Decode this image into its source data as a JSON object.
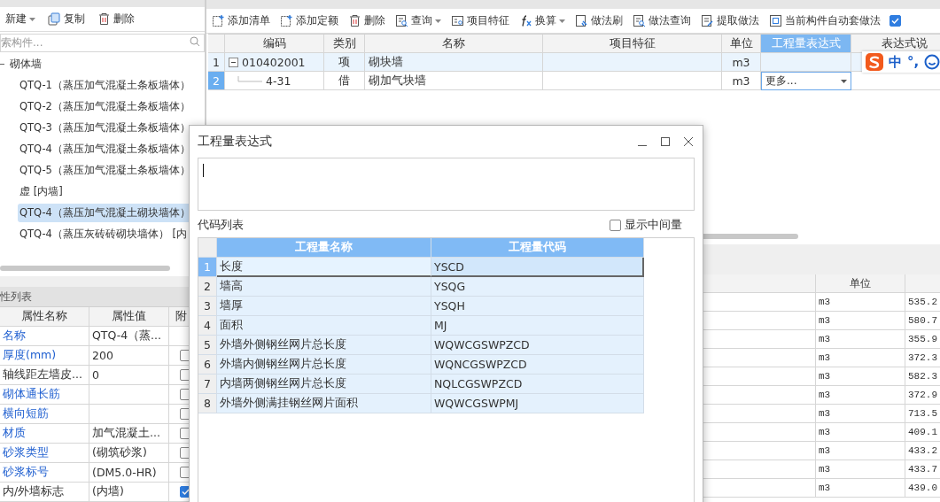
{
  "component_panel": {
    "toolbar": [
      {
        "label": "新建",
        "kind": "new",
        "dropdown": true
      },
      {
        "label": "复制",
        "kind": "copy",
        "dropdown": false
      },
      {
        "label": "删除",
        "kind": "delete",
        "dropdown": false
      }
    ],
    "search": {
      "placeholder": "索构件..."
    },
    "tree": [
      {
        "label": "砌体墙",
        "expanded": true,
        "selected": false,
        "children": [
          {
            "label": "QTQ-1（蒸压加气混凝土条板墙体）",
            "selected": false
          },
          {
            "label": "QTQ-2（蒸压加气混凝土条板墙体）",
            "selected": false
          },
          {
            "label": "QTQ-3（蒸压加气混凝土条板墙体）",
            "selected": false
          },
          {
            "label": "QTQ-4（蒸压加气混凝土条板墙体）",
            "selected": false
          },
          {
            "label": "QTQ-5（蒸压加气混凝土条板墙体）",
            "selected": false
          },
          {
            "label": "虚 [内墙]",
            "selected": false
          },
          {
            "label": "QTQ-4（蒸压加气混凝土砌块墙体）",
            "selected": true
          },
          {
            "label": "QTQ-4（蒸压灰砖砖砌块墙体） [内",
            "selected": false
          }
        ]
      }
    ]
  },
  "property_panel": {
    "title": "性列表",
    "columns": [
      "属性名称",
      "属性值",
      "附"
    ],
    "rows": [
      {
        "name": "名称",
        "value": "QTQ-4（蒸...",
        "kind": "public"
      },
      {
        "name": "厚度(mm)",
        "value": "200",
        "kind": "public",
        "checked": false
      },
      {
        "name": "轴线距左墙皮...",
        "value": "0",
        "kind": "private",
        "checked": false
      },
      {
        "name": "砌体通长筋",
        "value": "",
        "kind": "public",
        "checked": false
      },
      {
        "name": "横向短筋",
        "value": "",
        "kind": "public",
        "checked": false
      },
      {
        "name": "材质",
        "value": "加气混凝土...",
        "kind": "public",
        "checked": false
      },
      {
        "name": "砂浆类型",
        "value": "(砌筑砂浆)",
        "kind": "public",
        "checked": false
      },
      {
        "name": "砂浆标号",
        "value": "(DM5.0-HR)",
        "kind": "public",
        "checked": false
      },
      {
        "name": "内/外墙标志",
        "value": "(内墙)",
        "kind": "private",
        "checked": true
      }
    ]
  },
  "method_panel": {
    "toolbar": [
      {
        "label": "添加清单",
        "kind": "add-list",
        "dropdown": false
      },
      {
        "label": "添加定额",
        "kind": "add-quota",
        "dropdown": false
      },
      {
        "label": "删除",
        "kind": "delete",
        "dropdown": false
      },
      {
        "label": "查询",
        "kind": "query",
        "dropdown": true
      },
      {
        "label": "项目特征",
        "kind": "feature",
        "dropdown": false
      },
      {
        "label": "换算",
        "kind": "function",
        "dropdown": true
      },
      {
        "label": "做法刷",
        "kind": "brush",
        "dropdown": false
      },
      {
        "label": "做法查询",
        "kind": "query",
        "dropdown": false
      },
      {
        "label": "提取做法",
        "kind": "extract",
        "dropdown": false
      },
      {
        "label": "当前构件自动套做法",
        "kind": "auto",
        "dropdown": false
      }
    ],
    "auto_checkbox": {
      "checked": true
    },
    "columns": [
      {
        "label": "编码",
        "selected": false
      },
      {
        "label": "类别",
        "selected": false
      },
      {
        "label": "名称",
        "selected": false
      },
      {
        "label": "项目特征",
        "selected": false
      },
      {
        "label": "单位",
        "selected": false
      },
      {
        "label": "工程量表达式",
        "selected": true
      },
      {
        "label": "表达式说",
        "selected": false
      }
    ],
    "rows": [
      {
        "index": "1",
        "code": "010402001",
        "category": "项",
        "name": "砌块墙",
        "unit": "m3",
        "selected": false,
        "expanded": true,
        "children": [
          {
            "index": "2",
            "code": "4-31",
            "category": "借",
            "name": "砌加气块墙",
            "unit": "m3",
            "selected": true,
            "expression": {
              "kind": "dropdown",
              "value": "更多..."
            }
          }
        ]
      }
    ]
  },
  "ime_bar": {
    "items": [
      "中",
      "°,"
    ]
  },
  "quantity_table": {
    "columns": [
      "单位"
    ],
    "rows": [
      {
        "unit": "m3",
        "value": "535.2"
      },
      {
        "unit": "m3",
        "value": "580.7"
      },
      {
        "unit": "m3",
        "value": "355.9"
      },
      {
        "unit": "m3",
        "value": "372.3"
      },
      {
        "unit": "m3",
        "value": "582.3"
      },
      {
        "unit": "m3",
        "value": "372.9"
      },
      {
        "unit": "m3",
        "value": "713.5"
      },
      {
        "unit": "m3",
        "value": "409.1"
      },
      {
        "unit": "m3",
        "value": "433.2"
      },
      {
        "unit": "m3",
        "value": "433.7"
      },
      {
        "unit": "m3",
        "value": "439.0"
      }
    ]
  },
  "dialog": {
    "title": "工程量表达式",
    "code_list_label": "代码列表",
    "show_intermediate": {
      "label": "显示中间量",
      "checked": false
    },
    "columns": [
      "工程量名称",
      "工程量代码"
    ],
    "rows": [
      {
        "index": "1",
        "name": "长度",
        "code": "YSCD",
        "selected": true
      },
      {
        "index": "2",
        "name": "墙高",
        "code": "YSQG",
        "selected": false
      },
      {
        "index": "3",
        "name": "墙厚",
        "code": "YSQH",
        "selected": false
      },
      {
        "index": "4",
        "name": "面积",
        "code": "MJ",
        "selected": false
      },
      {
        "index": "5",
        "name": "外墙外侧钢丝网片总长度",
        "code": "WQWCGSWPZCD",
        "selected": false
      },
      {
        "index": "6",
        "name": "外墙内侧钢丝网片总长度",
        "code": "WQNCGSWPZCD",
        "selected": false
      },
      {
        "index": "7",
        "name": "内墙两侧钢丝网片总长度",
        "code": "NQLCGSWPZCD",
        "selected": false
      },
      {
        "index": "8",
        "name": "外墙外侧满挂钢丝网片面积",
        "code": "WQWCGSWPMJ",
        "selected": false
      }
    ]
  }
}
